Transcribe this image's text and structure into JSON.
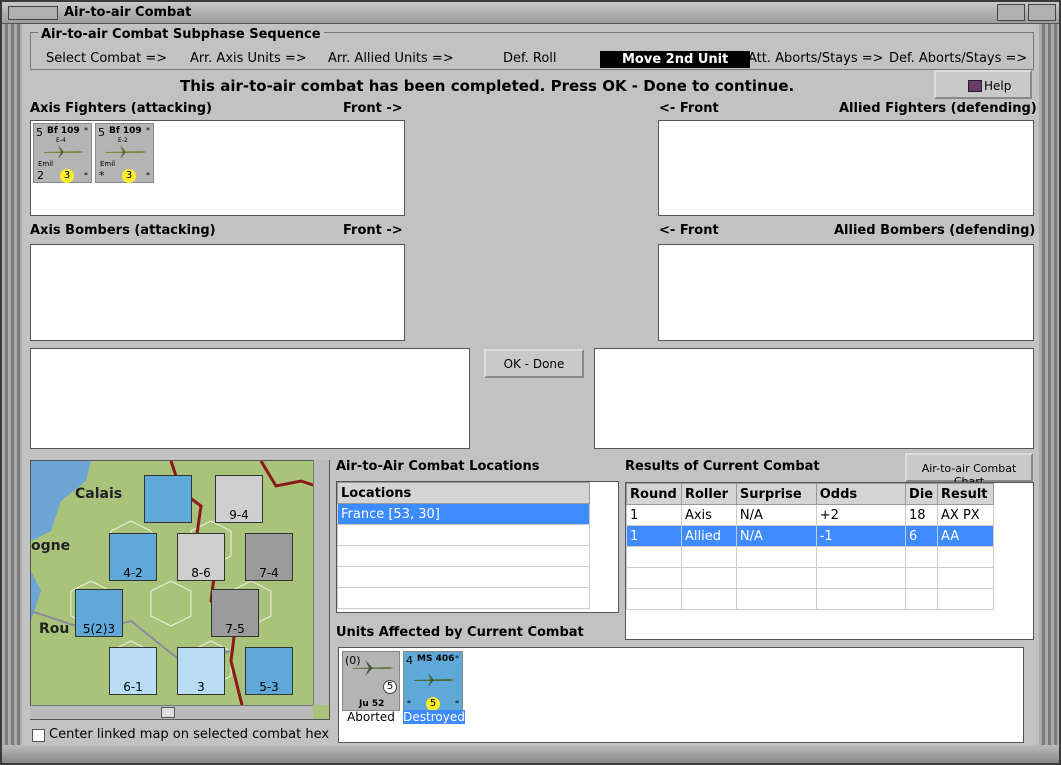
{
  "window": {
    "title": "Air-to-air Combat"
  },
  "sequence": {
    "title": "Air-to-air Combat Subphase Sequence",
    "steps": [
      "Select Combat =>",
      "Arr. Axis Units =>",
      "Arr. Allied Units =>",
      "Def. Roll",
      "Move 2nd Unit",
      "Att. Aborts/Stays =>",
      "Def. Aborts/Stays =>"
    ],
    "active_step": "Move 2nd Unit"
  },
  "status_message": "This air-to-air combat has been completed.  Press OK - Done to continue.",
  "help_label": "Help",
  "panels": {
    "axis_fighters": "Axis Fighters (attacking)",
    "axis_bombers": "Axis Bombers (attacking)",
    "allied_fighters": "Allied Fighters (defending)",
    "allied_bombers": "Allied Bombers (defending)",
    "front_right": "Front ->",
    "front_left": "<- Front"
  },
  "axis_fighter_counters": [
    {
      "top": "5",
      "type": "Bf 109",
      "variant": "E-4",
      "name": "Emil",
      "bottom": "2",
      "rating": "3"
    },
    {
      "top": "5",
      "type": "Bf 109",
      "variant": "E-2",
      "name": "Emil",
      "bottom": "*",
      "rating": "3"
    }
  ],
  "ok_label": "OK - Done",
  "map": {
    "labels": [
      "Calais",
      "ogne",
      "Rou"
    ],
    "units": [
      "9-4",
      "4-2",
      "8-6",
      "7-4",
      "5(2)3",
      "7-5",
      "6-1",
      "3",
      "5-3"
    ],
    "checkbox_label": "Center linked map on selected combat hex"
  },
  "locations": {
    "title": "Air-to-Air Combat Locations",
    "header": "Locations",
    "items": [
      "France [53, 30]"
    ]
  },
  "results": {
    "title": "Results of Current Combat",
    "chart_button": "Air-to-air Combat Chart",
    "headers": [
      "Round",
      "Roller",
      "Surprise",
      "Odds",
      "Die",
      "Result"
    ],
    "rows": [
      [
        "1",
        "Axis",
        "N/A",
        "+2",
        "18",
        "AX PX"
      ],
      [
        "1",
        "Allied",
        "N/A",
        "-1",
        "6",
        "AA"
      ]
    ]
  },
  "affected": {
    "title": "Units Affected by Current Combat",
    "units": [
      {
        "top": "(0)",
        "type": "Ju 52",
        "badge": "5",
        "status": "Aborted"
      },
      {
        "top": "4",
        "type": "MS 406",
        "badge": "5",
        "status": "Destroyed"
      }
    ]
  },
  "colors": {
    "selection": "#3d8bff",
    "counter_blue": "#5fa9d8",
    "rating_yellow": "#ffef2a",
    "active_step_bg": "#000000"
  }
}
